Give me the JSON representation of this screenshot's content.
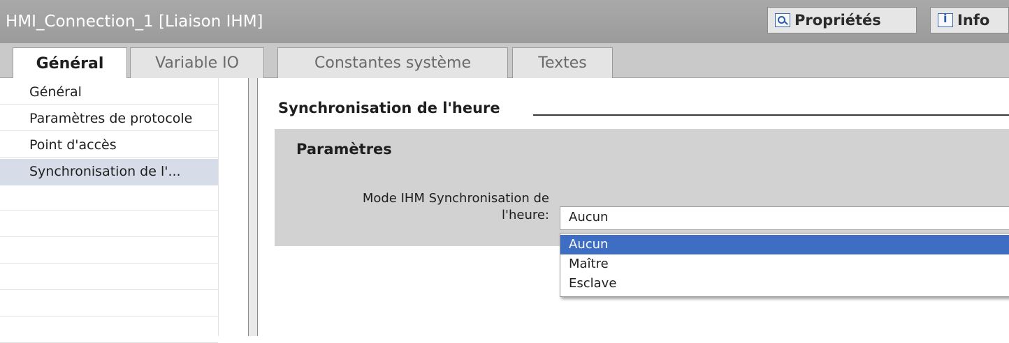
{
  "window": {
    "title": "HMI_Connection_1 [Liaison IHM]",
    "right_tabs": [
      {
        "label": "Propriétés",
        "icon": "properties-icon"
      },
      {
        "label": "Info",
        "icon": "info-icon"
      }
    ]
  },
  "tabs": [
    {
      "label": "Général",
      "active": true
    },
    {
      "label": "Variable IO",
      "active": false
    },
    {
      "label": "Constantes système",
      "active": false
    },
    {
      "label": "Textes",
      "active": false
    }
  ],
  "nav": {
    "items": [
      {
        "label": "Général",
        "selected": false
      },
      {
        "label": "Paramètres de protocole",
        "selected": false
      },
      {
        "label": "Point d'accès",
        "selected": false
      },
      {
        "label": "Synchronisation de l'...",
        "selected": true
      }
    ]
  },
  "main": {
    "section_title": "Synchronisation de l'heure",
    "panel_title": "Paramètres",
    "field_label_line1": "Mode IHM Synchronisation de",
    "field_label_line2": "l'heure:",
    "select_value": "Aucun",
    "options": [
      {
        "label": "Aucun",
        "highlighted": true
      },
      {
        "label": "Maître",
        "highlighted": false
      },
      {
        "label": "Esclave",
        "highlighted": false
      }
    ]
  },
  "colors": {
    "titlebar": "#9b9b9b",
    "selection": "#3d6ec4",
    "nav_selected": "#d6dde8",
    "panel": "#d2d2d2"
  }
}
